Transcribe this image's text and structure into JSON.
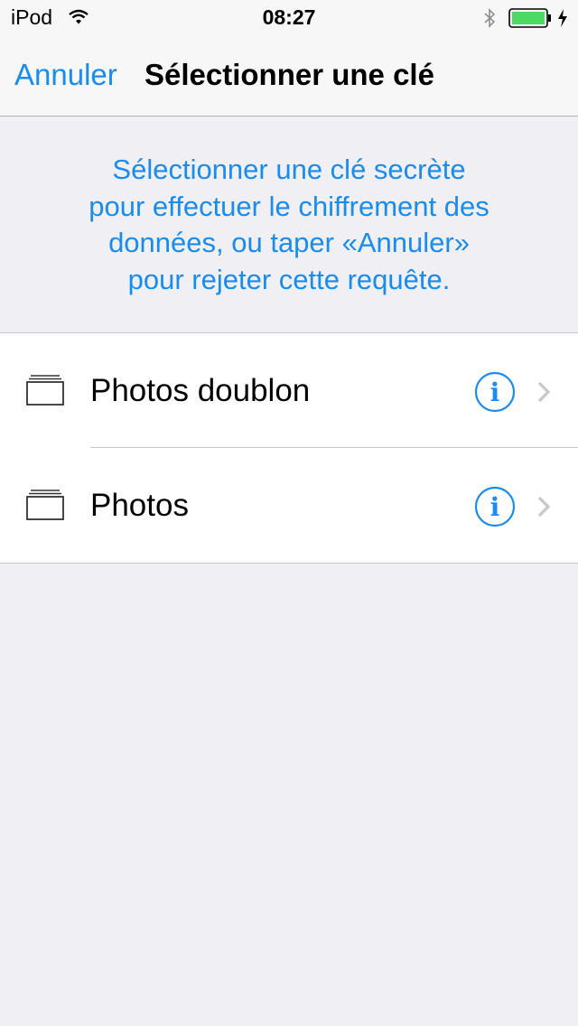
{
  "status_bar": {
    "carrier": "iPod",
    "time": "08:27",
    "wifi_icon": "wifi-icon",
    "bluetooth_icon": "bluetooth-icon",
    "battery_icon": "battery-icon",
    "charging_icon": "charging-bolt-icon",
    "battery_color": "#4cd964"
  },
  "nav": {
    "cancel_label": "Annuler",
    "title": "Sélectionner une clé"
  },
  "prompt": {
    "text": "Sélectionner une clé secrète\npour effectuer le chiffrement des\ndonnées, ou taper «Annuler»\npour rejeter cette requête."
  },
  "keys": [
    {
      "label": "Photos doublon",
      "icon": "key-folder-icon",
      "info_icon": "info-icon",
      "chevron_icon": "chevron-right-icon"
    },
    {
      "label": "Photos",
      "icon": "key-folder-icon",
      "info_icon": "info-icon",
      "chevron_icon": "chevron-right-icon"
    }
  ],
  "colors": {
    "accent": "#1a8cf0",
    "background": "#efeff4",
    "cell": "#ffffff",
    "separator": "#c8c7cc"
  }
}
